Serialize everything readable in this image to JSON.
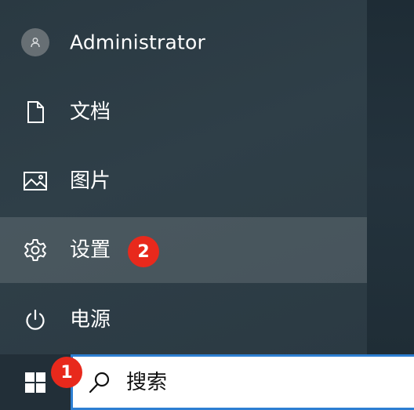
{
  "start_menu": {
    "items": [
      {
        "label": "Administrator",
        "icon": "user-avatar-icon"
      },
      {
        "label": "文档",
        "icon": "document-icon"
      },
      {
        "label": "图片",
        "icon": "pictures-icon"
      },
      {
        "label": "设置",
        "icon": "gear-icon",
        "highlighted": true
      },
      {
        "label": "电源",
        "icon": "power-icon"
      }
    ]
  },
  "taskbar": {
    "start_icon": "windows-logo-icon",
    "search": {
      "placeholder": "搜索",
      "icon": "search-icon"
    }
  },
  "badges": {
    "step1": "1",
    "step2": "2"
  },
  "colors": {
    "badge": "#e8291c",
    "search_border": "#2d7fd2",
    "menu_bg": "#2f3f48"
  }
}
